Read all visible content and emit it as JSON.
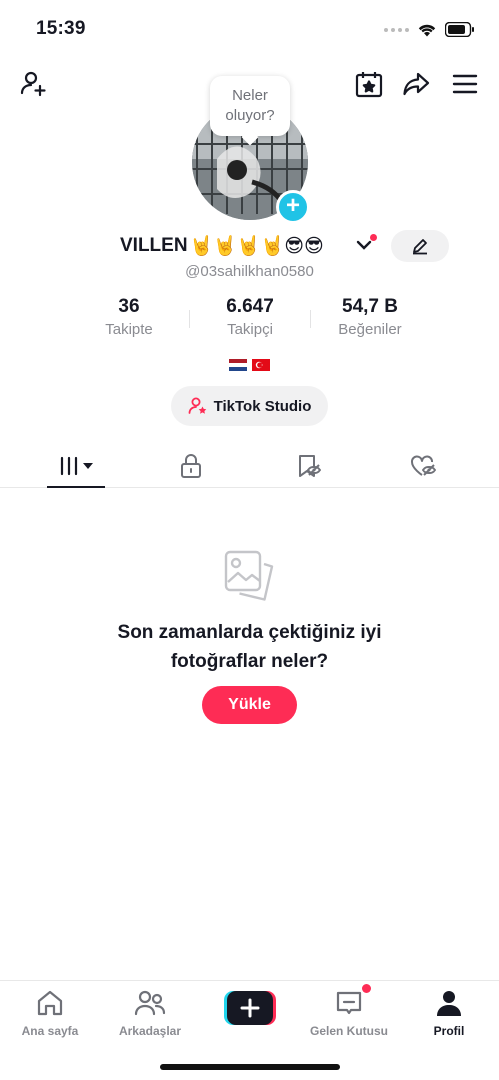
{
  "status_bar": {
    "time": "15:39"
  },
  "avatar_bubble": {
    "line1": "Neler",
    "line2": "oluyor?"
  },
  "profile": {
    "display_name": "VILLEN",
    "emojis": "🤘🤘🤘🤘😎😎",
    "handle": "@03sahilkhan0580"
  },
  "stats": [
    {
      "value": "36",
      "label": "Takipte"
    },
    {
      "value": "6.647",
      "label": "Takipçi"
    },
    {
      "value": "54,7 B",
      "label": "Beğeniler"
    }
  ],
  "studio_button": {
    "label": "TikTok Studio"
  },
  "empty_state": {
    "line1": "Son zamanlarda çektiğiniz iyi",
    "line2": "fotoğraflar neler?",
    "button": "Yükle"
  },
  "bottom_nav": {
    "home": "Ana sayfa",
    "friends": "Arkadaşlar",
    "inbox": "Gelen Kutusu",
    "profile": "Profil"
  },
  "colors": {
    "accent": "#fe2c55",
    "avatar_add": "#20c3e6",
    "text": "#161823",
    "muted": "#8a8b91"
  }
}
